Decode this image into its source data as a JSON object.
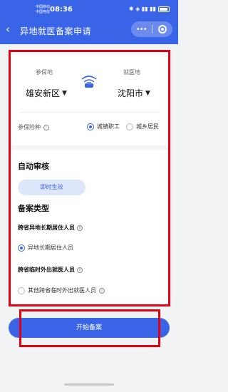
{
  "status_bar": {
    "carrier1": "中国移动",
    "carrier2": "中国电信",
    "time": "08:36",
    "icons": "✱ ◈ ▮▮ ▮▮"
  },
  "nav": {
    "back_icon": "‹",
    "title": "异地就医备案申请",
    "more_icon": "•••"
  },
  "location": {
    "insured_label": "参保地",
    "insured_city": "雄安新区",
    "medical_label": "就医地",
    "medical_city": "沈阳市",
    "caret": "▼"
  },
  "insurance": {
    "label": "参保险种",
    "options": [
      {
        "label": "城镇职工",
        "selected": true
      },
      {
        "label": "城乡居民",
        "selected": false
      }
    ]
  },
  "review": {
    "title": "自动审核",
    "badge": "即时生效"
  },
  "filing_type": {
    "title": "备案类型",
    "group1_title": "跨省异地长期居住人员",
    "group1_option": "异地长期居住人员",
    "group1_selected": true,
    "group2_title": "跨省临时外出就医人员",
    "group2_option": "其他跨省临时外出就医人员",
    "group2_selected": false
  },
  "actions": {
    "start_label": "开始备案"
  },
  "colors": {
    "primary": "#3a64e8",
    "highlight": "#e60012"
  }
}
